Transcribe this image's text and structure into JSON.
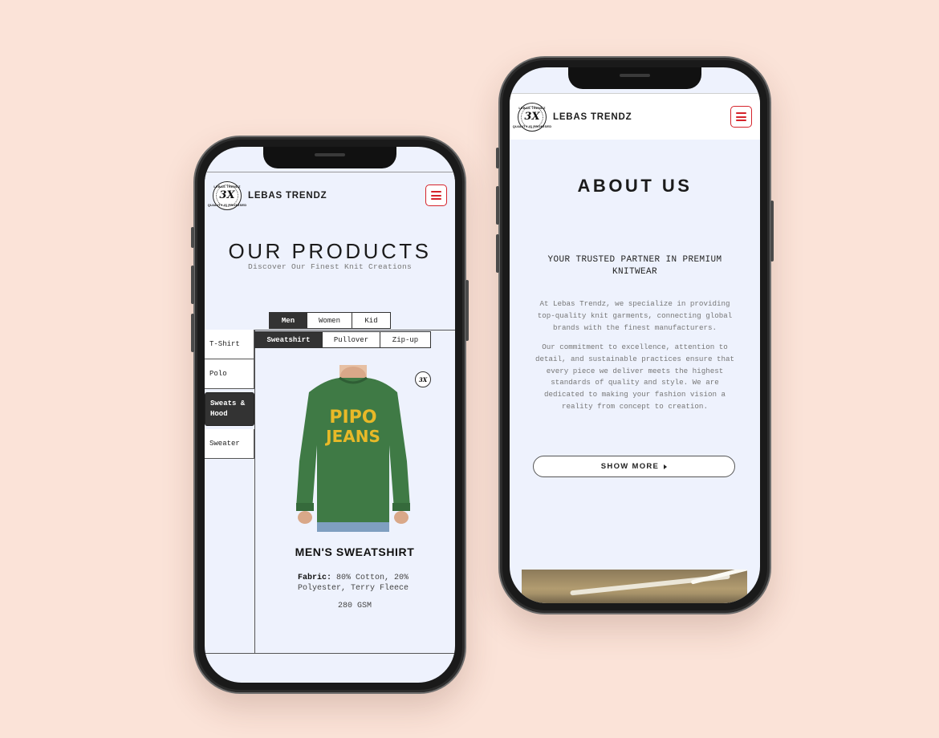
{
  "brand": {
    "name": "LEBAS TRENDZ",
    "logo_mark": "3X",
    "logo_top": "LEBAS TRENDZ",
    "logo_bottom": "QUALITY IS PROMISED"
  },
  "products_screen": {
    "title": "OUR PRODUCTS",
    "subtitle": "Discover Our Finest Knit Creations",
    "gender_tabs": [
      "Men",
      "Women",
      "Kid"
    ],
    "active_gender": "Men",
    "categories": [
      "T-Shirt",
      "Polo",
      "Sweats & Hood",
      "Sweater"
    ],
    "active_category": "Sweats & Hood",
    "sub_tabs": [
      "Sweatshirt",
      "Pullover",
      "Zip-up"
    ],
    "active_sub_tab": "Sweatshirt",
    "product": {
      "name": "MEN'S SWEATSHIRT",
      "fabric_label": "Fabric:",
      "fabric_value": "80% Cotton, 20% Polyester, Terry Fleece",
      "gsm": "280 GSM",
      "print_text_1": "PIPO",
      "print_text_2": "JEANS"
    }
  },
  "about_screen": {
    "title": "ABOUT US",
    "tagline": "YOUR TRUSTED PARTNER IN PREMIUM KNITWEAR",
    "paragraph_1": "At Lebas Trendz, we specialize in providing top-quality knit garments, connecting global brands with the finest manufacturers.",
    "paragraph_2": "Our commitment to excellence, attention to detail, and sustainable practices ensure that every piece we deliver meets the highest standards of quality and style. We are dedicated to making your fashion vision a reality from concept to creation.",
    "show_more_label": "SHOW MORE"
  },
  "colors": {
    "background": "#fbe3d8",
    "accent_red": "#d5232b",
    "screen": "#eef2fd",
    "dark_tab": "#333333",
    "sweatshirt_green": "#3f7a45",
    "print_yellow": "#e8b928"
  },
  "icons": {
    "menu": "hamburger-menu-icon",
    "show_more_arrow": "triangle-right-icon"
  }
}
